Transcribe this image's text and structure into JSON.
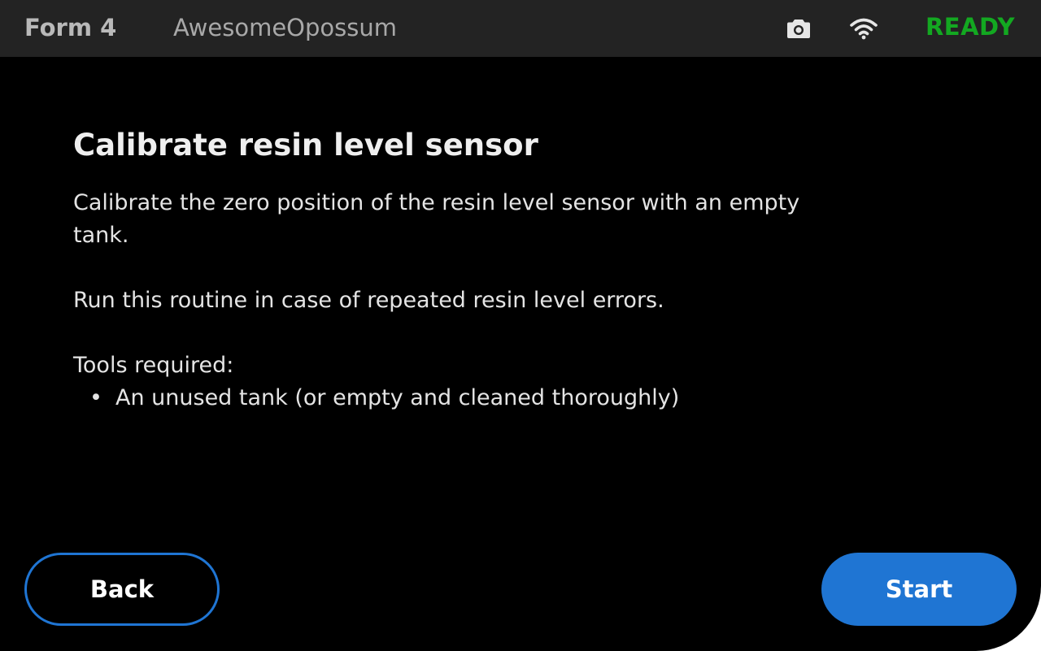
{
  "status_bar": {
    "model": "Form 4",
    "printer_name": "AwesomeOpossum",
    "status": "READY",
    "status_color": "#13a821",
    "icons": [
      "camera-icon",
      "wifi-icon"
    ]
  },
  "content": {
    "title": "Calibrate resin level sensor",
    "description_1": "Calibrate the zero position of the resin level sensor with an empty tank.",
    "description_2": "Run this routine in case of repeated resin level errors.",
    "tools_label": "Tools required:",
    "tools": [
      "An unused tank (or empty and cleaned thoroughly)"
    ]
  },
  "buttons": {
    "back_label": "Back",
    "start_label": "Start",
    "accent_color": "#1f75d3"
  }
}
